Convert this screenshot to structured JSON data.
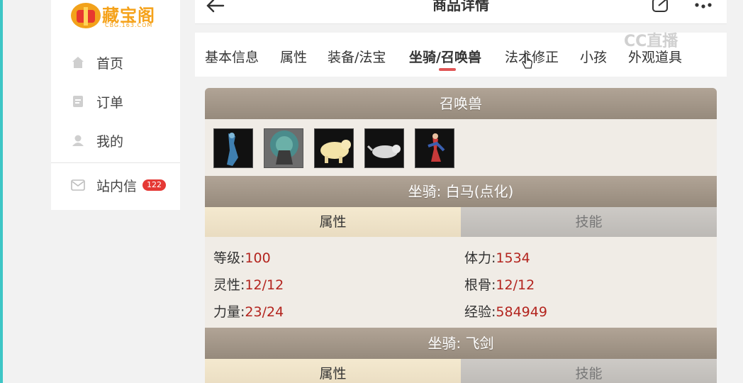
{
  "brand": {
    "name": "藏宝阁",
    "sub": "CBG.163.COM"
  },
  "sidebar": {
    "items": [
      {
        "label": "首页",
        "icon": "home-icon"
      },
      {
        "label": "订单",
        "icon": "order-icon"
      },
      {
        "label": "我的",
        "icon": "user-icon"
      }
    ],
    "messages": {
      "label": "站内信",
      "icon": "mail-icon",
      "count": "122"
    }
  },
  "header": {
    "title": "商品详情"
  },
  "tabs": [
    {
      "label": "基本信息"
    },
    {
      "label": "属性"
    },
    {
      "label": "装备/法宝"
    },
    {
      "label": "坐骑/召唤兽",
      "active": true
    },
    {
      "label": "法术修正"
    },
    {
      "label": "小孩"
    },
    {
      "label": "外观道具"
    }
  ],
  "watermark": "CC直播",
  "panel": {
    "pets_title": "召唤兽",
    "mount1": {
      "title": "坐骑: 白马(点化)",
      "tab_attr": "属性",
      "tab_skill": "技能",
      "stats": [
        {
          "label": "等级:",
          "value": "100"
        },
        {
          "label": "体力:",
          "value": "1534"
        },
        {
          "label": "灵性:",
          "value": "12/12"
        },
        {
          "label": "根骨:",
          "value": "12/12"
        },
        {
          "label": "力量:",
          "value": "23/24"
        },
        {
          "label": "经验:",
          "value": "584949"
        }
      ]
    },
    "mount2": {
      "title": "坐骑: 飞剑",
      "tab_attr": "属性",
      "tab_skill": "技能"
    }
  },
  "colors": {
    "accent": "#e05656",
    "value_red": "#b3241e",
    "section": "#a19484"
  }
}
